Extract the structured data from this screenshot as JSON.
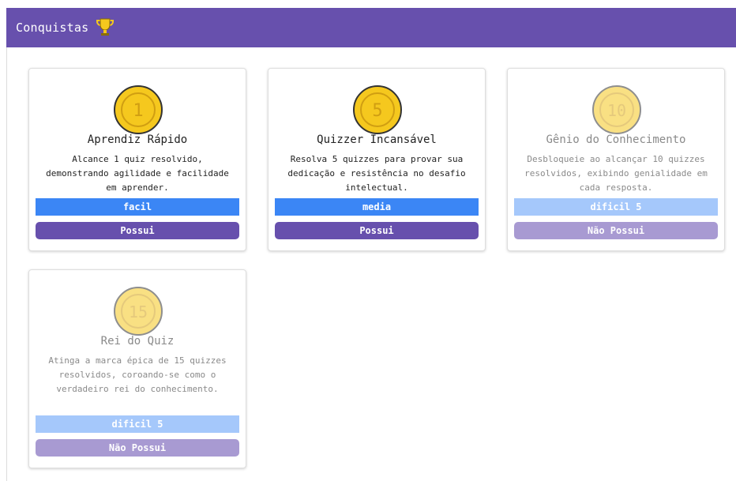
{
  "header": {
    "title": "Conquistas"
  },
  "colors": {
    "header": "#6750ad",
    "difficulty": "#3b86f5",
    "coin": "#f5c81e",
    "button": "#6750ad"
  },
  "achievements": [
    {
      "number": "1",
      "title": "Aprendiz Rápido",
      "description": "Alcance 1 quiz resolvido, demonstrando agilidade e facilidade em aprender.",
      "difficulty": "facil",
      "status": "Possui",
      "owned": true
    },
    {
      "number": "5",
      "title": "Quizzer Incansável",
      "description": "Resolva 5 quizzes para provar sua dedicação e resistência no desafio intelectual.",
      "difficulty": "media",
      "status": "Possui",
      "owned": true
    },
    {
      "number": "10",
      "title": "Gênio do Conhecimento",
      "description": "Desbloqueie ao alcançar 10 quizzes resolvidos, exibindo genialidade em cada resposta.",
      "difficulty": "dificil 5",
      "status": "Não Possui",
      "owned": false
    },
    {
      "number": "15",
      "title": "Rei do Quiz",
      "description": "Atinga a marca épica de 15 quizzes resolvidos, coroando-se como o verdadeiro rei do conhecimento.",
      "difficulty": "dificil 5",
      "status": "Não Possui",
      "owned": false
    }
  ]
}
